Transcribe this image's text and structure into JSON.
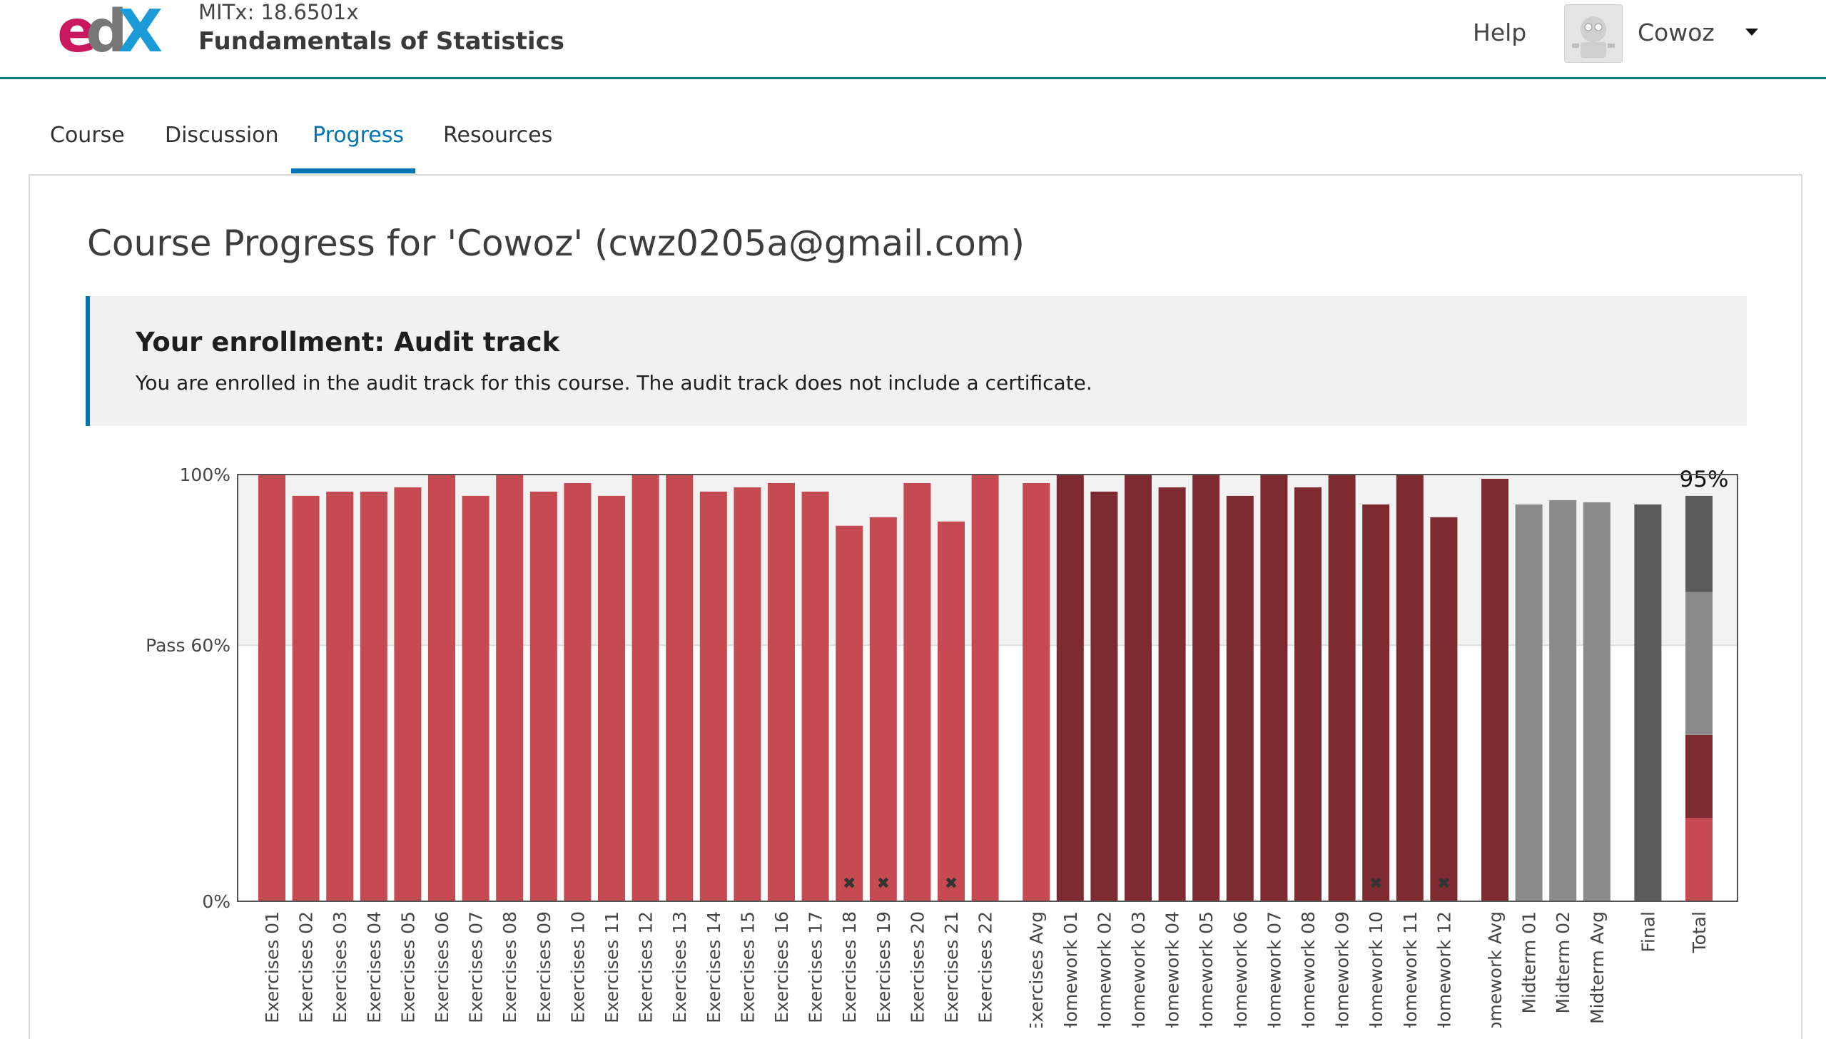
{
  "header": {
    "course_org": "MITx: 18.6501x",
    "course_title": "Fundamentals of Statistics",
    "help_label": "Help",
    "username": "Cowoz"
  },
  "tabs": [
    {
      "label": "Course",
      "active": false
    },
    {
      "label": "Discussion",
      "active": false
    },
    {
      "label": "Progress",
      "active": true
    },
    {
      "label": "Resources",
      "active": false
    }
  ],
  "page": {
    "title": "Course Progress for 'Cowoz' (cwz0205a@gmail.com)"
  },
  "enrollment_notice": {
    "heading": "Your enrollment: Audit track",
    "body": "You are enrolled in the audit track for this course. The audit track does not include a certificate."
  },
  "colors": {
    "accent_blue": "#0075b4",
    "header_border": "#0e7c7b",
    "exercises": "#c54a51",
    "homework": "#7d2a30",
    "midterm": "#8a8a8a",
    "final": "#5a5a5a",
    "pass_band": "#f2f2f2"
  },
  "chart_data": {
    "type": "bar",
    "ylim": [
      0,
      100
    ],
    "yticks": [
      {
        "value": 100,
        "label": "100%"
      },
      {
        "value": 60,
        "label": "Pass 60%"
      },
      {
        "value": 0,
        "label": "0%"
      }
    ],
    "pass_threshold": 60,
    "total_label": "95%",
    "bars": [
      {
        "label": "Exercises 01",
        "value": 100,
        "group": "exercises",
        "dropped": false
      },
      {
        "label": "Exercises 02",
        "value": 95,
        "group": "exercises",
        "dropped": false
      },
      {
        "label": "Exercises 03",
        "value": 96,
        "group": "exercises",
        "dropped": false
      },
      {
        "label": "Exercises 04",
        "value": 96,
        "group": "exercises",
        "dropped": false
      },
      {
        "label": "Exercises 05",
        "value": 97,
        "group": "exercises",
        "dropped": false
      },
      {
        "label": "Exercises 06",
        "value": 100,
        "group": "exercises",
        "dropped": false
      },
      {
        "label": "Exercises 07",
        "value": 95,
        "group": "exercises",
        "dropped": false
      },
      {
        "label": "Exercises 08",
        "value": 100,
        "group": "exercises",
        "dropped": false
      },
      {
        "label": "Exercises 09",
        "value": 96,
        "group": "exercises",
        "dropped": false
      },
      {
        "label": "Exercises 10",
        "value": 98,
        "group": "exercises",
        "dropped": false
      },
      {
        "label": "Exercises 11",
        "value": 95,
        "group": "exercises",
        "dropped": false
      },
      {
        "label": "Exercises 12",
        "value": 100,
        "group": "exercises",
        "dropped": false
      },
      {
        "label": "Exercises 13",
        "value": 100,
        "group": "exercises",
        "dropped": false
      },
      {
        "label": "Exercises 14",
        "value": 96,
        "group": "exercises",
        "dropped": false
      },
      {
        "label": "Exercises 15",
        "value": 97,
        "group": "exercises",
        "dropped": false
      },
      {
        "label": "Exercises 16",
        "value": 98,
        "group": "exercises",
        "dropped": false
      },
      {
        "label": "Exercises 17",
        "value": 96,
        "group": "exercises",
        "dropped": false
      },
      {
        "label": "Exercises 18",
        "value": 88,
        "group": "exercises",
        "dropped": true
      },
      {
        "label": "Exercises 19",
        "value": 90,
        "group": "exercises",
        "dropped": true
      },
      {
        "label": "Exercises 20",
        "value": 98,
        "group": "exercises",
        "dropped": false
      },
      {
        "label": "Exercises 21",
        "value": 89,
        "group": "exercises",
        "dropped": true
      },
      {
        "label": "Exercises 22",
        "value": 100,
        "group": "exercises",
        "dropped": false
      },
      {
        "label": "Exercises Avg",
        "value": 98,
        "group": "exercises",
        "dropped": false,
        "gap_before": true
      },
      {
        "label": "Homework 01",
        "value": 100,
        "group": "homework",
        "dropped": false
      },
      {
        "label": "Homework 02",
        "value": 96,
        "group": "homework",
        "dropped": false
      },
      {
        "label": "Homework 03",
        "value": 100,
        "group": "homework",
        "dropped": false
      },
      {
        "label": "Homework 04",
        "value": 97,
        "group": "homework",
        "dropped": false
      },
      {
        "label": "Homework 05",
        "value": 100,
        "group": "homework",
        "dropped": false
      },
      {
        "label": "Homework 06",
        "value": 95,
        "group": "homework",
        "dropped": false
      },
      {
        "label": "Homework 07",
        "value": 100,
        "group": "homework",
        "dropped": false
      },
      {
        "label": "Homework 08",
        "value": 97,
        "group": "homework",
        "dropped": false
      },
      {
        "label": "Homework 09",
        "value": 100,
        "group": "homework",
        "dropped": false
      },
      {
        "label": "Homework 10",
        "value": 93,
        "group": "homework",
        "dropped": true
      },
      {
        "label": "Homework 11",
        "value": 100,
        "group": "homework",
        "dropped": false
      },
      {
        "label": "Homework 12",
        "value": 90,
        "group": "homework",
        "dropped": true
      },
      {
        "label": "Homework Avg",
        "value": 99,
        "group": "homework",
        "dropped": false,
        "gap_before": true
      },
      {
        "label": "Midterm 01",
        "value": 93,
        "group": "midterm",
        "dropped": false
      },
      {
        "label": "Midterm 02",
        "value": 94,
        "group": "midterm",
        "dropped": false
      },
      {
        "label": "Midterm Avg",
        "value": 93.5,
        "group": "midterm",
        "dropped": false
      },
      {
        "label": "Final",
        "value": 93,
        "group": "final",
        "dropped": false,
        "gap_before": true
      },
      {
        "label": "Total",
        "value": 95,
        "group": "total",
        "dropped": false,
        "gap_before": true
      }
    ],
    "total_segments": [
      {
        "group": "exercises",
        "value": 19.5
      },
      {
        "group": "homework",
        "value": 19.5
      },
      {
        "group": "midterm",
        "value": 33.5
      },
      {
        "group": "final",
        "value": 22.5
      }
    ]
  }
}
